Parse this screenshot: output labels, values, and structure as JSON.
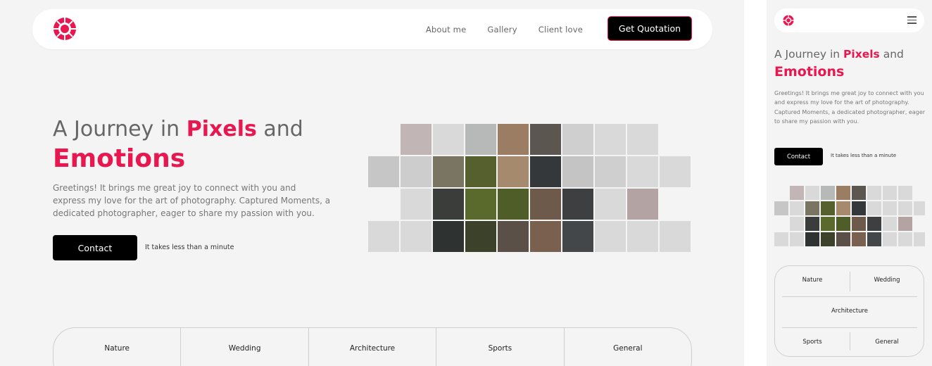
{
  "brand": {
    "accent": "#e8174f",
    "logo_icon": "aperture-logo-icon"
  },
  "nav": {
    "links": [
      "About me",
      "Gallery",
      "Client love"
    ],
    "cta_label": "Get Quotation"
  },
  "hero": {
    "title_pre": "A Journey in ",
    "title_accent": "Pixels",
    "title_post": " and",
    "title_line2": "Emotions",
    "description": "Greetings! It brings me great joy to connect with you and express my love for the art of photography. Captured Moments, a dedicated photographer, eager to share my passion with you.",
    "contact_label": "Contact",
    "contact_note": "It takes less than a minute"
  },
  "mosaic": {
    "image_subject": "child on man's shoulders photo"
  },
  "categories": [
    "Nature",
    "Wedding",
    "Architecture",
    "Sports",
    "General"
  ],
  "mobile": {
    "menu_icon": "hamburger-menu-icon"
  }
}
